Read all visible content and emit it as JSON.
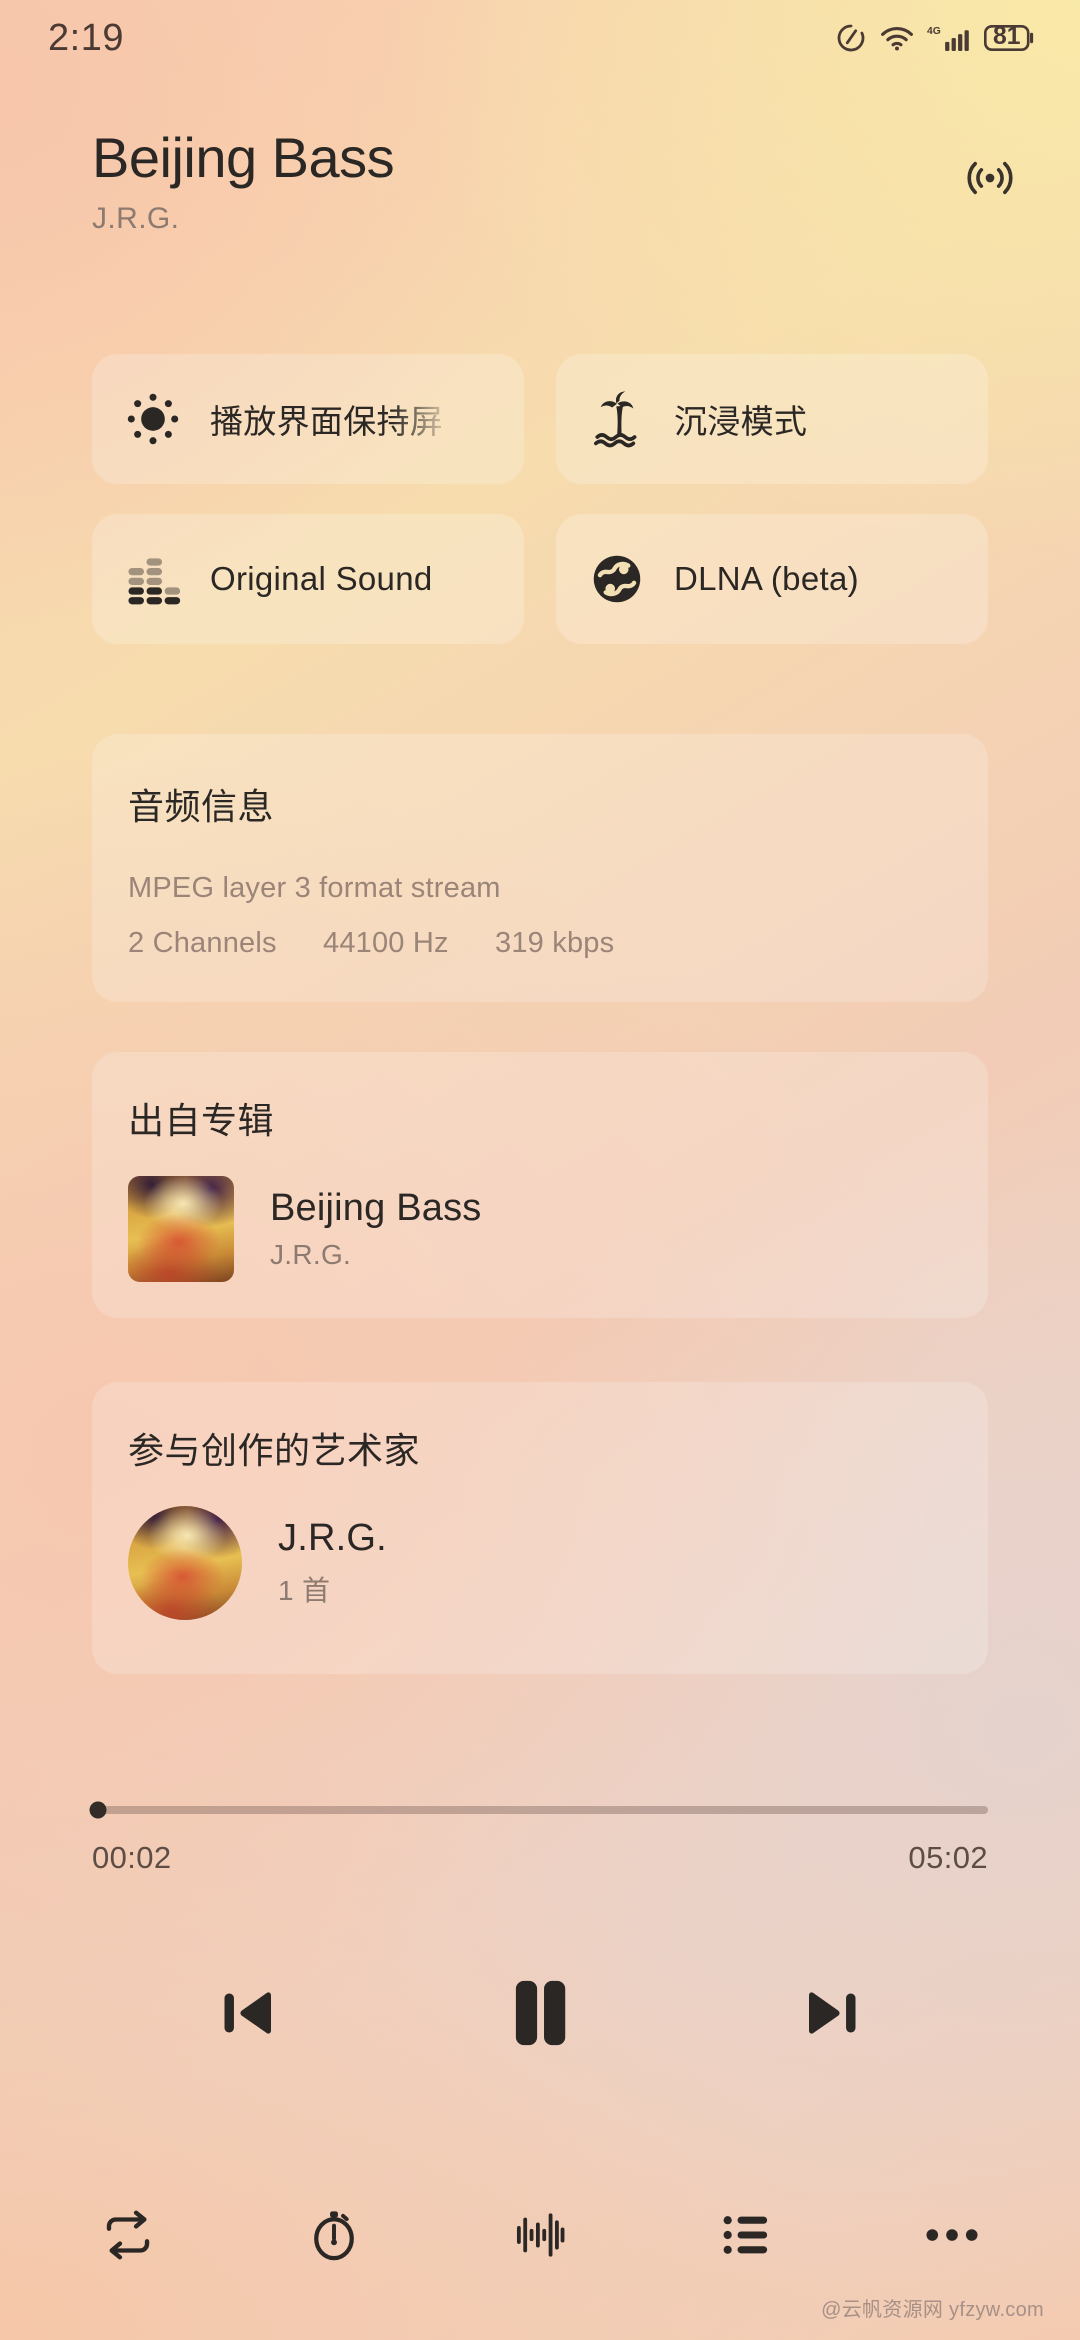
{
  "status_bar": {
    "time": "2:19",
    "battery_level": "81",
    "network_type": "4G",
    "icons": [
      "dnd-icon",
      "wifi-icon",
      "signal-icon",
      "battery-icon"
    ]
  },
  "header": {
    "title": "Beijing Bass",
    "artist": "J.R.G.",
    "cast_icon": "broadcast-icon"
  },
  "toggles": [
    {
      "icon": "sun-icon",
      "label": "播放界面保持屏",
      "clipped": true
    },
    {
      "icon": "palm-tree-icon",
      "label": "沉浸模式",
      "clipped": false
    },
    {
      "icon": "equalizer-icon",
      "label": "Original Sound",
      "clipped": false
    },
    {
      "icon": "dlna-icon",
      "label": "DLNA (beta)",
      "clipped": false
    }
  ],
  "audio_info": {
    "title": "音频信息",
    "format": "MPEG layer 3 format stream",
    "channels": "2 Channels",
    "sample_rate": "44100 Hz",
    "bitrate": "319 kbps"
  },
  "album_section": {
    "title": "出自专辑",
    "album_name": "Beijing Bass",
    "album_artist": "J.R.G."
  },
  "artist_section": {
    "title": "参与创作的艺术家",
    "artist_name": "J.R.G.",
    "track_count": "1 首"
  },
  "playback": {
    "current_time": "00:02",
    "total_time": "05:02",
    "progress_percent": "0.7",
    "controls": [
      "previous-track-button",
      "pause-button",
      "next-track-button"
    ]
  },
  "bottom_bar": [
    "repeat-icon",
    "sleep-timer-icon",
    "visualizer-icon",
    "playlist-queue-icon",
    "more-options-icon"
  ],
  "watermark": "@云帆资源网 yfzyw.com",
  "colors": {
    "text_primary": "#2b2724",
    "text_secondary": "#8d7a70",
    "accent": "#332c27",
    "card_bg": "rgba(255,255,255,0.20)"
  }
}
